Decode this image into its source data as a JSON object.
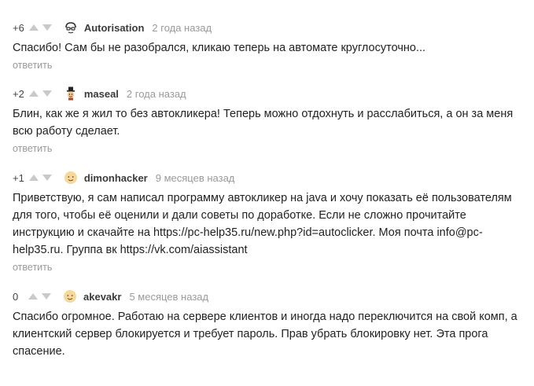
{
  "comments": [
    {
      "score": "+6",
      "author": "Autorisation",
      "date": "2 года назад",
      "text": "Спасибо! Сам бы не разобрался, кликаю теперь на автомате круглосуточно...",
      "reply": "ответить",
      "avatar": "glasses-face-avatar"
    },
    {
      "score": "+2",
      "author": "maseal",
      "date": "2 года назад",
      "text": "Блин, как же я жил то без автокликера! Теперь можно отдохнуть и расслабиться, а он за меня всю работу сделает.",
      "reply": "ответить",
      "avatar": "top-hat-avatar"
    },
    {
      "score": "+1",
      "author": "dimonhacker",
      "date": "9 месяцев назад",
      "text": "Приветствую, я сам написал программу автокликер на java и хочу показать её пользователям для того, чтобы её оценили и дали советы по доработке. Если не сложно прочитайте инструкцию и скачайте на https://pc-help35.ru/new.php?id=autoclicker. Моя почта info@pc-help35.ru. Группа вк https://vk.com/aiassistant",
      "reply": "ответить",
      "avatar": "smiley-avatar"
    },
    {
      "score": "0",
      "author": "akevakr",
      "date": "5 месяцев назад",
      "text": "Спасибо огромное. Работаю на сервере клиентов и иногда надо переключится на свой комп, а клиентский сервер блокируется и требует пароль. Прав убрать блокировку нет. Эта прога спасение.",
      "reply": "",
      "avatar": "smiley-avatar"
    }
  ]
}
